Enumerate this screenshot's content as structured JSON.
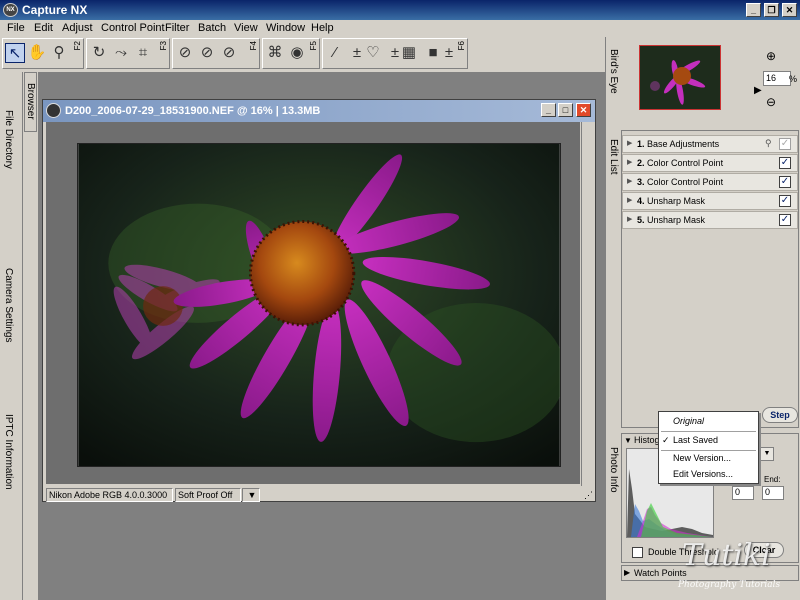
{
  "app": {
    "title": "Capture NX"
  },
  "menu": [
    "File",
    "Edit",
    "Adjust",
    "Control Point",
    "Filter",
    "Batch",
    "View",
    "Window",
    "Help"
  ],
  "toolbar": {
    "fkeys": [
      "F2",
      "F3",
      "F4",
      "F5",
      "F6"
    ]
  },
  "left_tabs": {
    "browser": "Browser",
    "file_directory": "File Directory",
    "camera_settings": "Camera Settings",
    "iptc": "IPTC Information"
  },
  "image_window": {
    "title": "D200_2006-07-29_18531900.NEF  @ 16%  |  13.3MB",
    "profile": "Nikon Adobe RGB 4.0.0.3000",
    "soft_proof": "Soft Proof Off"
  },
  "birds_eye": {
    "label": "Bird's Eye",
    "zoom_value": "16",
    "zoom_unit": "%"
  },
  "edit_list": {
    "label": "Edit List",
    "step_label": "Step",
    "items": [
      {
        "num": "1.",
        "label": "Base Adjustments",
        "checked": true
      },
      {
        "num": "2.",
        "label": "Color Control Point",
        "checked": true
      },
      {
        "num": "3.",
        "label": "Color Control Point",
        "checked": true
      },
      {
        "num": "4.",
        "label": "Unsharp Mask",
        "checked": true
      },
      {
        "num": "5.",
        "label": "Unsharp Mask",
        "checked": true
      }
    ]
  },
  "version_menu": {
    "items": [
      "Original",
      "Last Saved",
      "New Version...",
      "Edit Versions..."
    ],
    "checked": "Last Saved"
  },
  "photo_info": {
    "label": "Photo Info",
    "histogram_label": "Histogr",
    "end_label": "End:",
    "start_value": "0",
    "end_value": "0",
    "double_threshold": "Double Threshold",
    "clear": "Clear",
    "watch_points": "Watch Points"
  },
  "watermark": {
    "text": "Tutiki",
    "sub": "Photography Tutorials"
  }
}
